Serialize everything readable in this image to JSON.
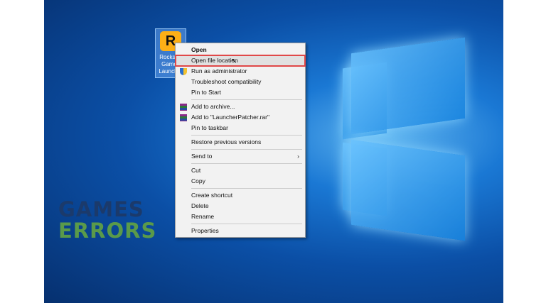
{
  "desktop_icon": {
    "label": "Rockstar Games Launcher",
    "logo_letter": "R"
  },
  "menu": {
    "items": [
      {
        "label": "Open",
        "bold": true
      },
      {
        "label": "Open file location",
        "highlighted": true
      },
      {
        "label": "Run as administrator",
        "icon": "shield-icon"
      },
      {
        "label": "Troubleshoot compatibility"
      },
      {
        "label": "Pin to Start"
      },
      {
        "label": "Add to archive...",
        "icon": "winrar-icon"
      },
      {
        "label": "Add to \"LauncherPatcher.rar\"",
        "icon": "winrar-icon"
      },
      {
        "label": "Pin to taskbar"
      },
      {
        "label": "Restore previous versions"
      },
      {
        "label": "Send to",
        "submenu": true
      },
      {
        "label": "Cut"
      },
      {
        "label": "Copy"
      },
      {
        "label": "Create shortcut"
      },
      {
        "label": "Delete"
      },
      {
        "label": "Rename"
      },
      {
        "label": "Properties"
      }
    ]
  },
  "watermark": {
    "line1": "GAMES",
    "line2": "ERRORS",
    "color1": "#1b3a6b",
    "color2": "#5a9a4a"
  },
  "colors": {
    "highlight_border": "#e04848"
  }
}
